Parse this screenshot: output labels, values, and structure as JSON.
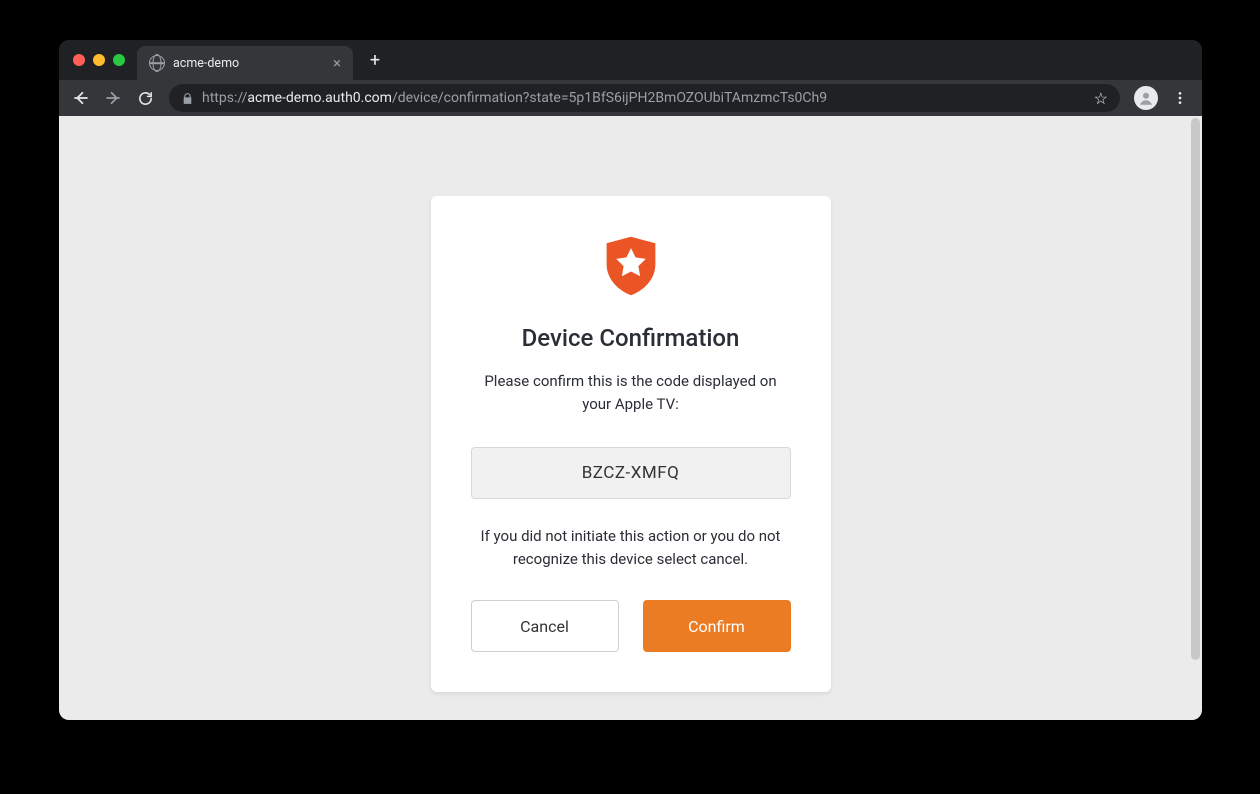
{
  "browser": {
    "tab_title": "acme-demo",
    "url_scheme": "https://",
    "url_host": "acme-demo.auth0.com",
    "url_path": "/device/confirmation?state=5p1BfS6ijPH2BmOZOUbiTAmzmcTs0Ch9"
  },
  "card": {
    "title": "Device Confirmation",
    "lead": "Please confirm this is the code displayed on your Apple TV:",
    "code": "BZCZ-XMFQ",
    "sub": "If you did not initiate this action or you do not recognize this device select cancel.",
    "cancel_label": "Cancel",
    "confirm_label": "Confirm"
  },
  "colors": {
    "accent": "#eb5424"
  }
}
